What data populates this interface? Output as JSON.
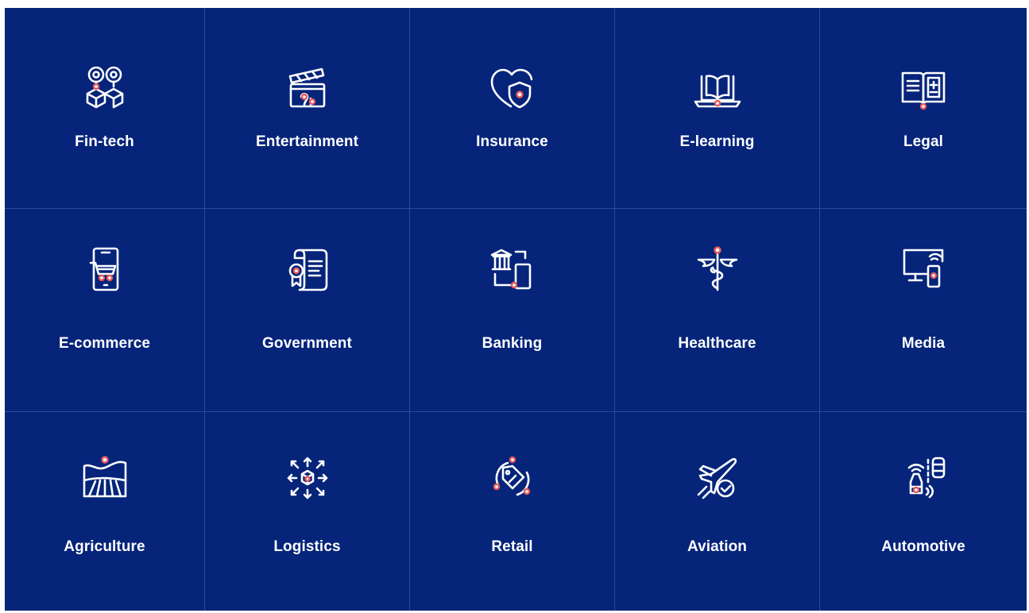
{
  "industries": [
    {
      "label": "Fin-tech",
      "icon": "coins-boxes-icon"
    },
    {
      "label": "Entertainment",
      "icon": "clapperboard-icon"
    },
    {
      "label": "Insurance",
      "icon": "heart-shield-icon"
    },
    {
      "label": "E-learning",
      "icon": "book-laptop-icon"
    },
    {
      "label": "Legal",
      "icon": "law-book-icon"
    },
    {
      "label": "E-commerce",
      "icon": "mobile-cart-icon"
    },
    {
      "label": "Government",
      "icon": "certificate-document-icon"
    },
    {
      "label": "Banking",
      "icon": "bank-mobile-icon"
    },
    {
      "label": "Healthcare",
      "icon": "caduceus-icon"
    },
    {
      "label": "Media",
      "icon": "monitor-remote-icon"
    },
    {
      "label": "Agriculture",
      "icon": "field-icon"
    },
    {
      "label": "Logistics",
      "icon": "cube-arrows-icon"
    },
    {
      "label": "Retail",
      "icon": "shopping-tag-icon"
    },
    {
      "label": "Aviation",
      "icon": "airplane-check-icon"
    },
    {
      "label": "Automotive",
      "icon": "connected-car-icon"
    }
  ],
  "colors": {
    "background": "#05247a",
    "grid_line": "#2c4c9e",
    "icon_stroke": "#ffffff",
    "accent": "#e8595b"
  }
}
